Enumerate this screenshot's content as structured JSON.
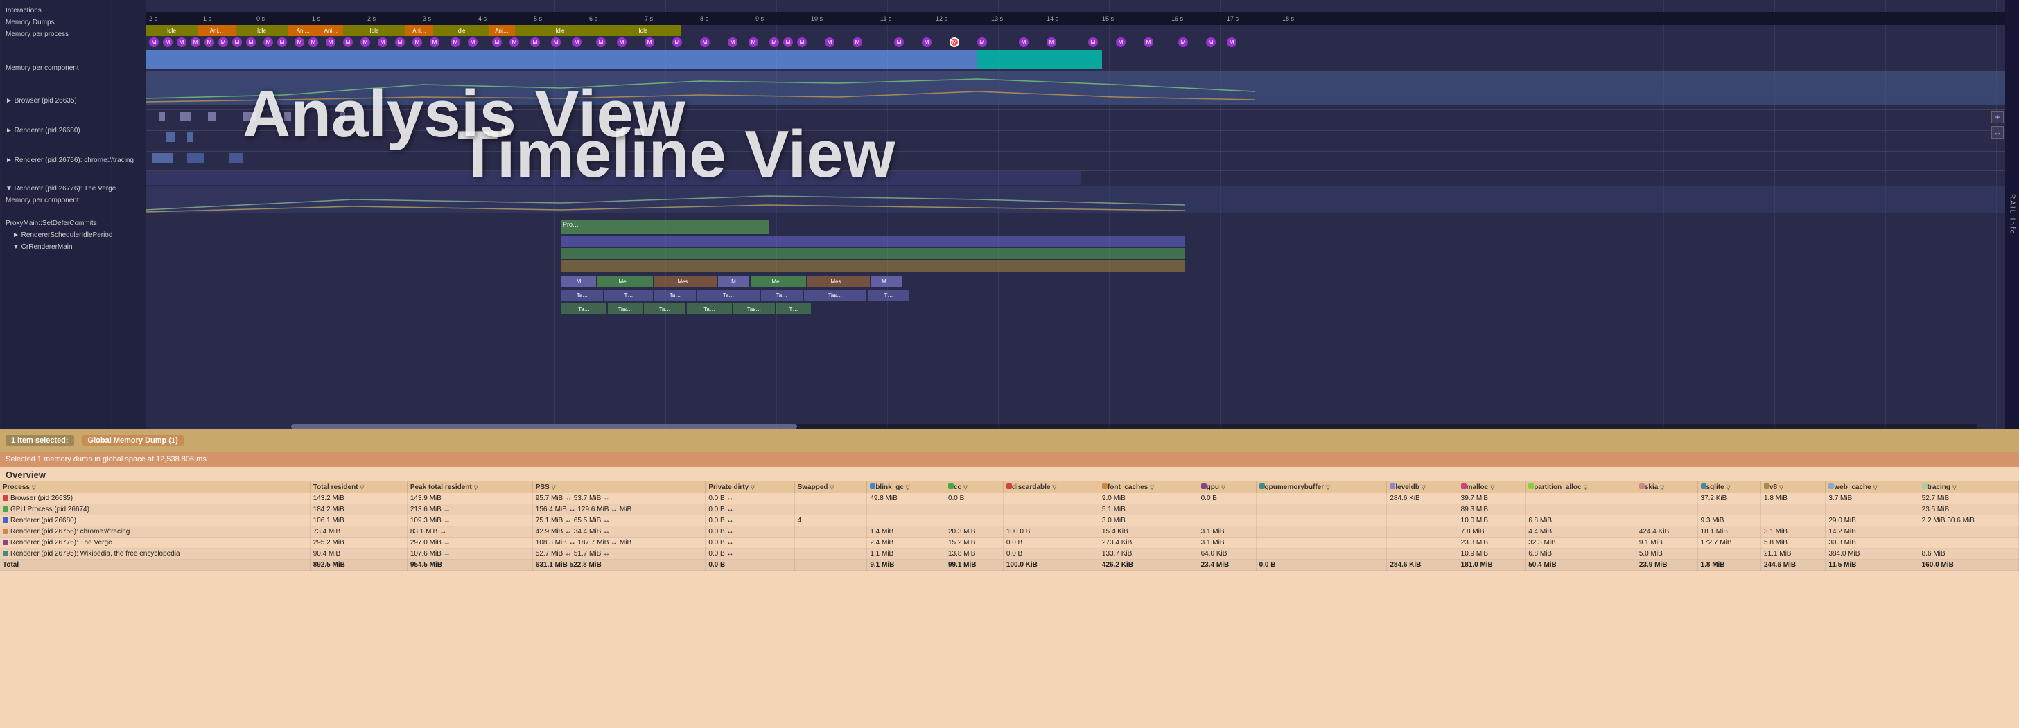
{
  "timeline": {
    "title": "Timeline View",
    "left_labels": [
      {
        "text": "Interactions",
        "indent": 0
      },
      {
        "text": "Memory Dumps",
        "indent": 0
      },
      {
        "text": "Memory per process",
        "indent": 0
      },
      {
        "text": "",
        "indent": 0
      },
      {
        "text": "Memory per component",
        "indent": 0
      },
      {
        "text": "",
        "indent": 0
      },
      {
        "text": "► Browser (pid 26635)",
        "indent": 0
      },
      {
        "text": "",
        "indent": 0
      },
      {
        "text": "► Renderer (pid 26680)",
        "indent": 0
      },
      {
        "text": "",
        "indent": 0
      },
      {
        "text": "► Renderer (pid 26756): chrome://tracing",
        "indent": 0
      },
      {
        "text": "",
        "indent": 0
      },
      {
        "text": "▼ Renderer (pid 26776): The Verge",
        "indent": 0
      },
      {
        "text": "Memory per component",
        "indent": 0
      },
      {
        "text": "",
        "indent": 0
      },
      {
        "text": "ProxyMain::SetDeferCommits",
        "indent": 0
      },
      {
        "text": "► RendererSchedulerIdlePeriod",
        "indent": 2
      },
      {
        "text": "▼ CrRendererMain",
        "indent": 2
      }
    ],
    "time_labels": [
      "2s",
      "1s",
      "0s",
      "1s",
      "2s",
      "3s",
      "4s",
      "5s",
      "6s",
      "7s",
      "8s",
      "9s",
      "10s",
      "11s",
      "12s",
      "13s",
      "14s",
      "15s",
      "16s",
      "17s",
      "18s"
    ],
    "idle_ani_blocks": [
      {
        "type": "idle",
        "label": "Idle",
        "width": 80
      },
      {
        "type": "ani",
        "label": "Ani…",
        "width": 60
      },
      {
        "type": "idle",
        "label": "Idle",
        "width": 80
      },
      {
        "type": "ani",
        "label": "Ani…",
        "width": 60
      },
      {
        "type": "ani",
        "label": "Ani…",
        "width": 40
      },
      {
        "type": "idle",
        "label": "Idle",
        "width": 100
      },
      {
        "type": "ani",
        "label": "Ani…",
        "width": 50
      },
      {
        "type": "idle",
        "label": "Idle",
        "width": 90
      },
      {
        "type": "ani",
        "label": "Ani…",
        "width": 40
      },
      {
        "type": "idle",
        "label": "Idle",
        "width": 150
      },
      {
        "type": "idle",
        "label": "Idle",
        "width": 120
      }
    ],
    "rail_info": "RAIL Info",
    "controls": [
      "+",
      "↔"
    ]
  },
  "selection_bar": {
    "count_label": "1 item selected:",
    "item_label": "Global Memory Dump (1)",
    "info_text": "Selected 1 memory dump in global space at 12,538.806 ms"
  },
  "overview": {
    "title": "Overview",
    "columns": [
      {
        "label": "Process",
        "sort": "▽",
        "dot_color": null
      },
      {
        "label": "Total resident",
        "sort": "▽",
        "dot_color": null
      },
      {
        "label": "Peak total resident",
        "sort": "▽",
        "dot_color": null
      },
      {
        "label": "PSS",
        "sort": "▽",
        "dot_color": null
      },
      {
        "label": "Private dirty",
        "sort": "▽",
        "dot_color": null
      },
      {
        "label": "Swapped",
        "sort": "▽",
        "dot_color": null
      },
      {
        "label": "blink_gc",
        "sort": "▽",
        "dot_color": "#4488cc"
      },
      {
        "label": "cc",
        "sort": "▽",
        "dot_color": "#44aa44"
      },
      {
        "label": "discardable",
        "sort": "▽",
        "dot_color": "#cc4444"
      },
      {
        "label": "font_caches",
        "sort": "▽",
        "dot_color": "#cc8844"
      },
      {
        "label": "gpu",
        "sort": "▽",
        "dot_color": "#884488"
      },
      {
        "label": "gpumemorybuffer",
        "sort": "▽",
        "dot_color": "#448888"
      },
      {
        "label": "leveldb",
        "sort": "▽",
        "dot_color": "#8888cc"
      },
      {
        "label": "malloc",
        "sort": "▽",
        "dot_color": "#cc4488"
      },
      {
        "label": "partition_alloc",
        "sort": "▽",
        "dot_color": "#88cc44"
      },
      {
        "label": "skia",
        "sort": "▽",
        "dot_color": "#cc8888"
      },
      {
        "label": "sqlite",
        "sort": "▽",
        "dot_color": "#4488aa"
      },
      {
        "label": "v8",
        "sort": "▽",
        "dot_color": "#aa8844"
      },
      {
        "label": "web_cache",
        "sort": "▽",
        "dot_color": "#88aacc"
      },
      {
        "label": "tracing",
        "sort": "▽",
        "dot_color": "#aaccaa"
      }
    ],
    "rows": [
      {
        "process": "Browser (pid 26635)",
        "dot_color": "#cc4444",
        "total_resident": "143.2 MiB",
        "peak_total_resident": "143.9 MiB →",
        "pss": "95.7 MiB ↔ 53.7 MiB ↔",
        "private_dirty": "0.0 B ↔",
        "swapped": "",
        "blink_gc": "49.8 MiB",
        "cc": "0.0 B",
        "discardable": "",
        "font_caches": "9.0 MiB",
        "gpu": "0.0 B",
        "gpumemorybuffer": "",
        "leveldb": "284.6 KiB",
        "malloc": "39.7 MiB",
        "partition_alloc": "",
        "skia": "",
        "sqlite": "37.2 KiB",
        "v8": "1.8 MiB",
        "web_cache": "3.7 MiB",
        "tracing": "52.7 MiB"
      },
      {
        "process": "GPU Process (pid 26674)",
        "dot_color": "#44aa44",
        "total_resident": "184.2 MiB",
        "peak_total_resident": "213.6 MiB →",
        "pss": "156.4 MiB ↔ 129.6 MiB ↔",
        "private_dirty": "0.0 B ↔",
        "swapped": "",
        "blink_gc": "",
        "cc": "",
        "discardable": "",
        "font_caches": "5.1 MiB",
        "gpu": "",
        "gpumemorybuffer": "",
        "leveldb": "",
        "malloc": "89.3 MiB",
        "partition_alloc": "",
        "skia": "",
        "sqlite": "",
        "v8": "",
        "web_cache": "",
        "tracing": "23.5 MiB"
      },
      {
        "process": "Renderer (pid 26680)",
        "dot_color": "#4466cc",
        "total_resident": "106.1 MiB",
        "peak_total_resident": "109.3 MiB →",
        "pss": "75.1 MiB ↔ 65.5 MiB ↔",
        "private_dirty": "0.0 B ↔",
        "swapped": "4",
        "blink_gc": "",
        "cc": "",
        "discardable": "",
        "font_caches": "3.0 MiB",
        "gpu": "",
        "gpumemorybuffer": "",
        "leveldb": "",
        "malloc": "10.0 MiB",
        "partition_alloc": "6.8 MiB",
        "skia": "",
        "sqlite": "9.3 MiB",
        "v8": "",
        "web_cache": "29.0 MiB",
        "tracing": "2.2 MiB 30.6 MiB"
      },
      {
        "process": "Renderer (pid 26756): chrome://tracing",
        "dot_color": "#cc8844",
        "total_resident": "73.4 MiB",
        "peak_total_resident": "83.1 MiB →",
        "pss": "42.9 MiB ↔ 34.4 MiB ↔",
        "private_dirty": "0.0 B ↔",
        "swapped": "",
        "blink_gc": "1.4 MiB",
        "cc": "20.3 MiB",
        "discardable": "100.0 B",
        "font_caches": "15.4 KiB",
        "gpu": "3.1 MiB",
        "gpumemorybuffer": "",
        "leveldb": "",
        "malloc": "7.8 MiB",
        "partition_alloc": "4.4 MiB",
        "skia": "424.4 KiB",
        "sqlite": "18.1 MiB",
        "v8": "3.1 MiB",
        "web_cache": "14.2 MiB",
        "tracing": ""
      },
      {
        "process": "Renderer (pid 26776): The Verge",
        "dot_color": "#884488",
        "total_resident": "295.2 MiB",
        "peak_total_resident": "297.0 MiB →",
        "pss": "108.3 MiB ↔ 187.7 MiB ↔",
        "private_dirty": "0.0 B ↔",
        "swapped": "",
        "blink_gc": "2.4 MiB",
        "cc": "15.2 MiB",
        "discardable": "0.0 B",
        "font_caches": "273.4 KiB",
        "gpu": "3.1 MiB",
        "gpumemorybuffer": "",
        "leveldb": "",
        "malloc": "23.3 MiB",
        "partition_alloc": "32.3 MiB",
        "skia": "9.1 MiB",
        "sqlite": "172.7 MiB",
        "v8": "5.8 MiB",
        "web_cache": "30.3 MiB",
        "tracing": ""
      },
      {
        "process": "Renderer (pid 26795): Wikipedia, the free encyclopedia",
        "dot_color": "#448888",
        "total_resident": "90.4 MiB",
        "peak_total_resident": "107.6 MiB →",
        "pss": "52.7 MiB ↔ 51.7 MiB ↔",
        "private_dirty": "0.0 B ↔",
        "swapped": "",
        "blink_gc": "1.1 MiB",
        "cc": "13.8 MiB",
        "discardable": "0.0 B",
        "font_caches": "133.7 KiB",
        "gpu": "64.0 KiB",
        "gpumemorybuffer": "",
        "leveldb": "",
        "malloc": "10.9 MiB",
        "partition_alloc": "6.8 MiB",
        "skia": "5.0 MiB",
        "sqlite": "",
        "v8": "21.1 MiB",
        "web_cache": "384.0 MiB",
        "tracing": "8.6 MiB"
      },
      {
        "process": "Total",
        "dot_color": null,
        "total_resident": "892.5 MiB",
        "peak_total_resident": "954.5 MiB",
        "pss": "631.1 MiB 522.8 MiB",
        "private_dirty": "0.0 B",
        "swapped": "",
        "blink_gc": "9.1 MiB",
        "cc": "99.1 MiB",
        "discardable": "100.0 KiB",
        "font_caches": "426.2 KiB",
        "gpu": "23.4 MiB",
        "gpumemorybuffer": "0.0 B",
        "leveldb": "284.6 KiB",
        "malloc": "181.0 MiB",
        "partition_alloc": "50.4 MiB",
        "skia": "23.9 MiB",
        "sqlite": "1.8 MiB",
        "v8": "244.6 MiB",
        "web_cache": "11.5 MiB",
        "tracing": "160.0 MiB"
      }
    ]
  }
}
